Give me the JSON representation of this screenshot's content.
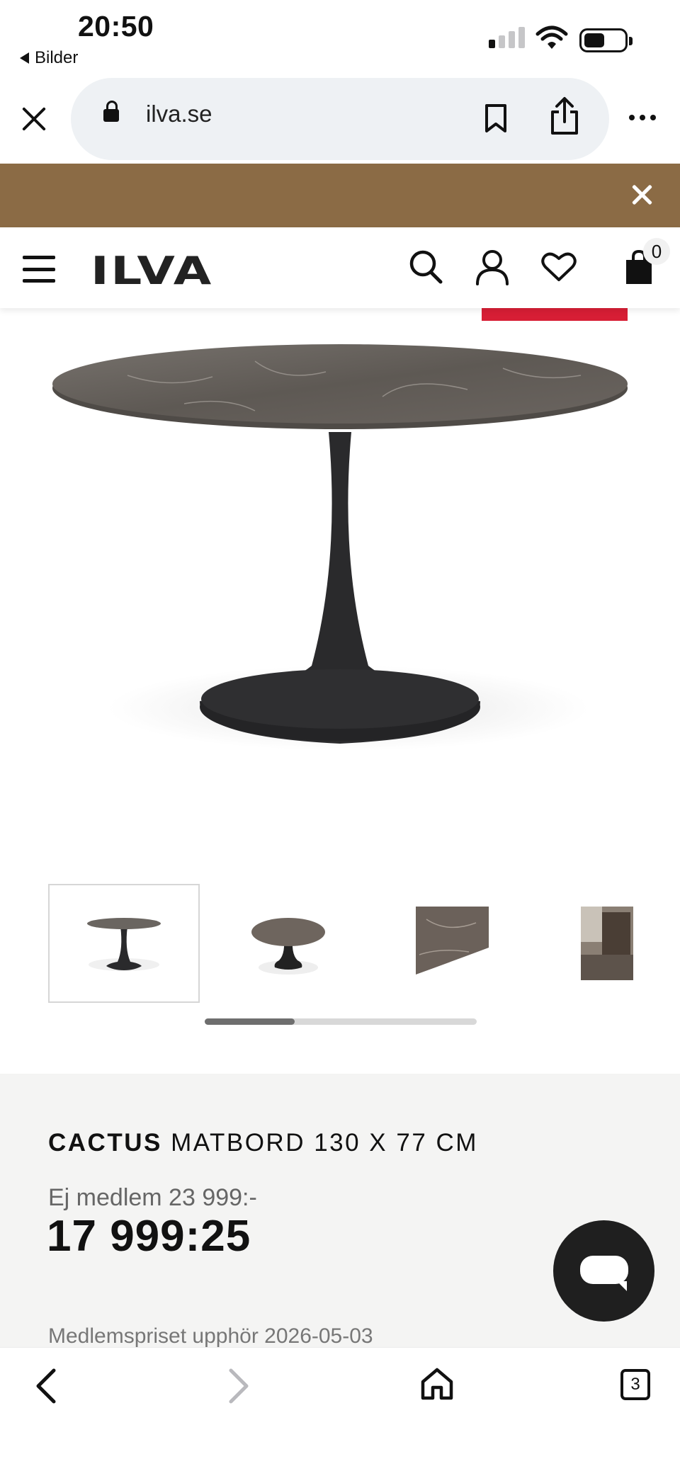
{
  "status_bar": {
    "time": "20:50",
    "back_app": "Bilder"
  },
  "browser": {
    "url": "ilva.se",
    "tab_count": "3"
  },
  "site": {
    "logo": "ILVA",
    "cart_count": "0"
  },
  "product": {
    "brand": "CACTUS",
    "name": "MATBORD 130 X 77 CM",
    "non_member_price": "Ej medlem 23 999:-",
    "price": "17 999:25",
    "member_note": "Medlemspriset upphör 2026-05-03"
  },
  "gallery": {
    "thumbnail_count": 4,
    "active_index": 0,
    "scroll_fraction": 0.33
  },
  "colors": {
    "promo_banner": "#8b6b45",
    "sale_tag": "#d71e35",
    "info_background": "#f4f4f3"
  }
}
